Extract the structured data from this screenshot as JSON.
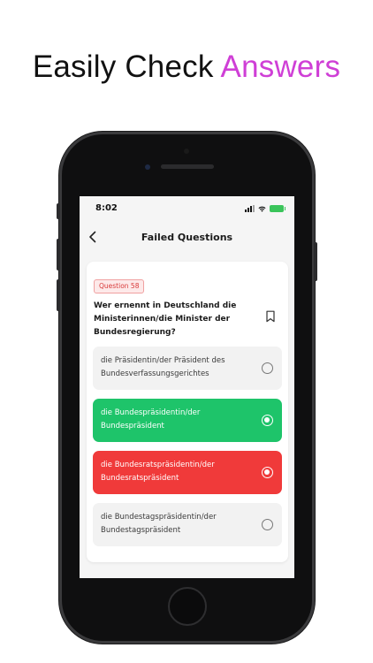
{
  "headline": {
    "prefix": "Easily Check",
    "accent": "Answers"
  },
  "status_bar": {
    "time": "8:02"
  },
  "nav": {
    "title": "Failed Questions",
    "back_icon": "chevron-left-icon"
  },
  "question": {
    "badge": "Question 58",
    "text": "Wer ernennt in Deutschland die Ministerinnen/die Minister der Bundesregierung?",
    "bookmark_icon": "bookmark-icon"
  },
  "options": [
    {
      "text": "die Präsidentin/der Präsident des Bundesverfassungsgerichtes",
      "state": "neutral"
    },
    {
      "text": "die Bundespräsidentin/der Bundespräsident",
      "state": "correct"
    },
    {
      "text": "die Bundesratspräsidentin/der Bundesratspräsident",
      "state": "wrong"
    },
    {
      "text": "die Bundestagspräsidentin/der Bundestagspräsident",
      "state": "neutral"
    }
  ],
  "colors": {
    "accent": "#cf3fd6",
    "correct": "#1ec46a",
    "wrong": "#f03a3a",
    "badge_text": "#d83a3a"
  }
}
